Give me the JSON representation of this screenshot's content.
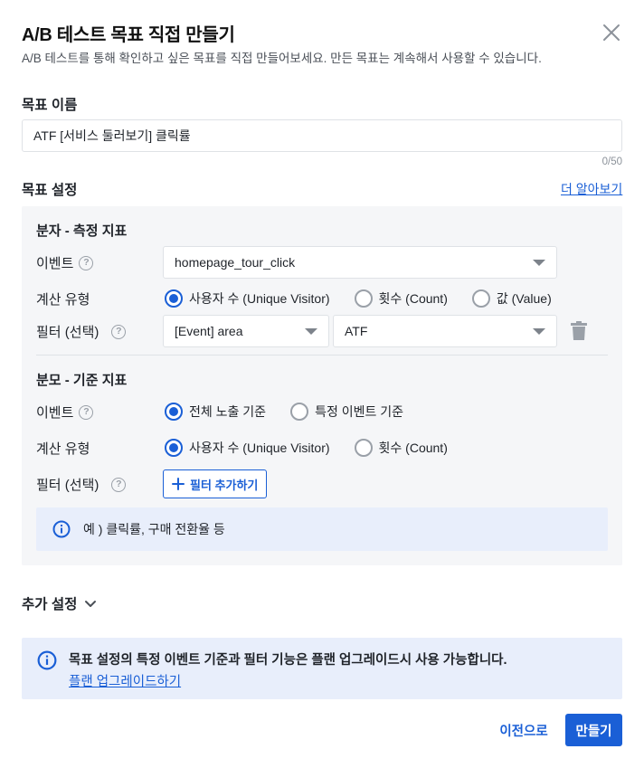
{
  "dialog": {
    "title": "A/B 테스트 목표 직접 만들기",
    "subtitle": "A/B 테스트를 통해 확인하고 싶은 목표를 직접 만들어보세요. 만든 목표는 계속해서 사용할 수 있습니다."
  },
  "goal_name": {
    "label": "목표 이름",
    "value": "ATF [서비스 둘러보기] 클릭률",
    "counter": "0/50"
  },
  "goal_settings": {
    "label": "목표 설정",
    "learn_more": "더 알아보기"
  },
  "numerator": {
    "title": "분자 - 측정 지표",
    "event_label": "이벤트",
    "event_value": "homepage_tour_click",
    "calc_label": "계산 유형",
    "calc_options": [
      "사용자 수 (Unique Visitor)",
      "횟수 (Count)",
      "값 (Value)"
    ],
    "calc_selected": 0,
    "filter_label": "필터 (선택)",
    "filter_key": "[Event] area",
    "filter_value": "ATF"
  },
  "denominator": {
    "title": "분모 - 기준 지표",
    "event_label": "이벤트",
    "event_options": [
      "전체 노출 기준",
      "특정 이벤트 기준"
    ],
    "event_selected": 0,
    "calc_label": "계산 유형",
    "calc_options": [
      "사용자 수 (Unique Visitor)",
      "횟수 (Count)"
    ],
    "calc_selected": 0,
    "filter_label": "필터 (선택)",
    "add_filter": "필터 추가하기"
  },
  "info": {
    "example": "예 ) 클릭률, 구매 전환율 등"
  },
  "extra_settings": {
    "label": "추가 설정"
  },
  "plan_notice": {
    "text": "목표 설정의 특정 이벤트 기준과 필터 기능은 플랜 업그레이드시 사용 가능합니다.",
    "link": "플랜 업그레이드하기"
  },
  "footer": {
    "prev": "이전으로",
    "create": "만들기"
  },
  "colors": {
    "accent": "#1a5fd6",
    "panel_bg": "#f5f6f8",
    "info_bg": "#e8eefb"
  }
}
